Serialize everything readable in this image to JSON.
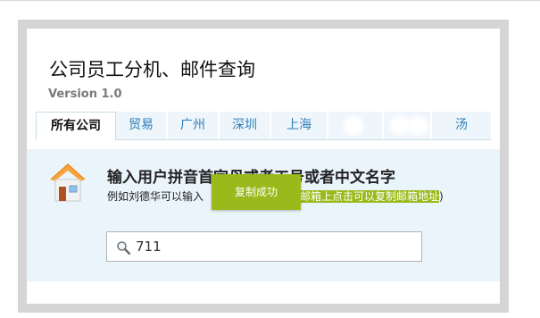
{
  "app": {
    "title": "公司员工分机、邮件查询",
    "version": "Version 1.0"
  },
  "tabs": [
    {
      "label": "所有公司",
      "active": true
    },
    {
      "label": "贸易",
      "active": false
    },
    {
      "label": "广州",
      "active": false
    },
    {
      "label": "深圳",
      "active": false
    },
    {
      "label": "上海",
      "active": false
    },
    {
      "label": "",
      "active": false
    },
    {
      "label": "",
      "active": false
    },
    {
      "label": "汤",
      "active": false
    }
  ],
  "search": {
    "heading": "输入用户拼音首字母或者工号或者中文名字",
    "hint_prefix": "例如刘德华可以输入",
    "hint_highlight": "到邮箱上点击可以复制邮箱地址",
    "hint_suffix": ")",
    "value": "711",
    "toast": "复制成功"
  },
  "icons": {
    "house": "house-icon",
    "search": "magnifier-icon"
  },
  "colors": {
    "accent": "#9ab91a",
    "tab_text": "#2c7fb8",
    "content_bg": "#eaf4fb",
    "frame": "#d5d5d5"
  }
}
